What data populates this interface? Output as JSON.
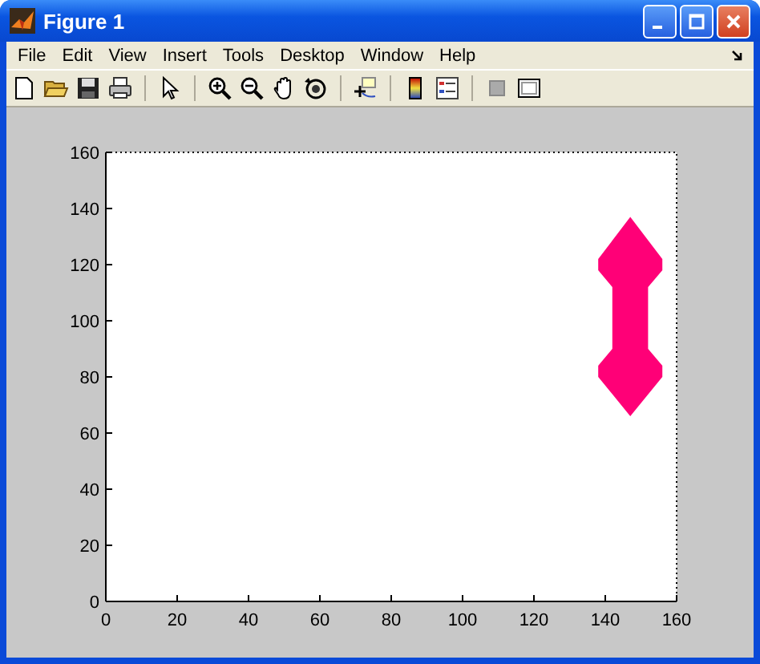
{
  "window": {
    "title": "Figure 1"
  },
  "menu": [
    "File",
    "Edit",
    "View",
    "Insert",
    "Tools",
    "Desktop",
    "Window",
    "Help"
  ],
  "plot": {
    "chart_data": {
      "type": "area",
      "xlim": [
        0,
        160
      ],
      "ylim": [
        0,
        160
      ],
      "xticks": [
        0,
        20,
        40,
        60,
        80,
        100,
        120,
        140,
        160
      ],
      "yticks": [
        0,
        20,
        40,
        60,
        80,
        100,
        120,
        140,
        160
      ],
      "x": [
        147,
        138,
        138,
        142,
        142,
        138,
        138,
        147,
        156,
        156,
        152,
        152,
        156,
        156
      ],
      "series": [
        {
          "color": "#ff0077",
          "values": [
            137,
            122,
            118,
            112,
            90,
            84,
            80,
            66,
            80,
            84,
            90,
            112,
            118,
            122
          ]
        }
      ]
    }
  }
}
